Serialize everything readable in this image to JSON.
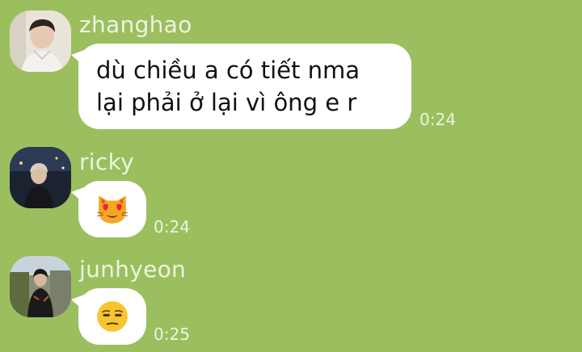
{
  "messages": [
    {
      "sender": "zhanghao",
      "avatar_icon": "person-avatar-zhanghao",
      "text_lines": [
        "dù chiều a có tiết nma",
        "lại phải ở lại vì ông e r"
      ],
      "time": "0:24"
    },
    {
      "sender": "ricky",
      "avatar_icon": "person-avatar-ricky",
      "emoji": "smiling-cat-with-heart-eyes-emoji",
      "time": "0:24"
    },
    {
      "sender": "junhyeon",
      "avatar_icon": "person-avatar-junhyeon",
      "emoji": "unamused-face-emoji",
      "time": "0:25"
    }
  ],
  "colors": {
    "chat_background": "#9bbf5e",
    "bubble": "#ffffff",
    "meta_text": "#eef3e2"
  }
}
